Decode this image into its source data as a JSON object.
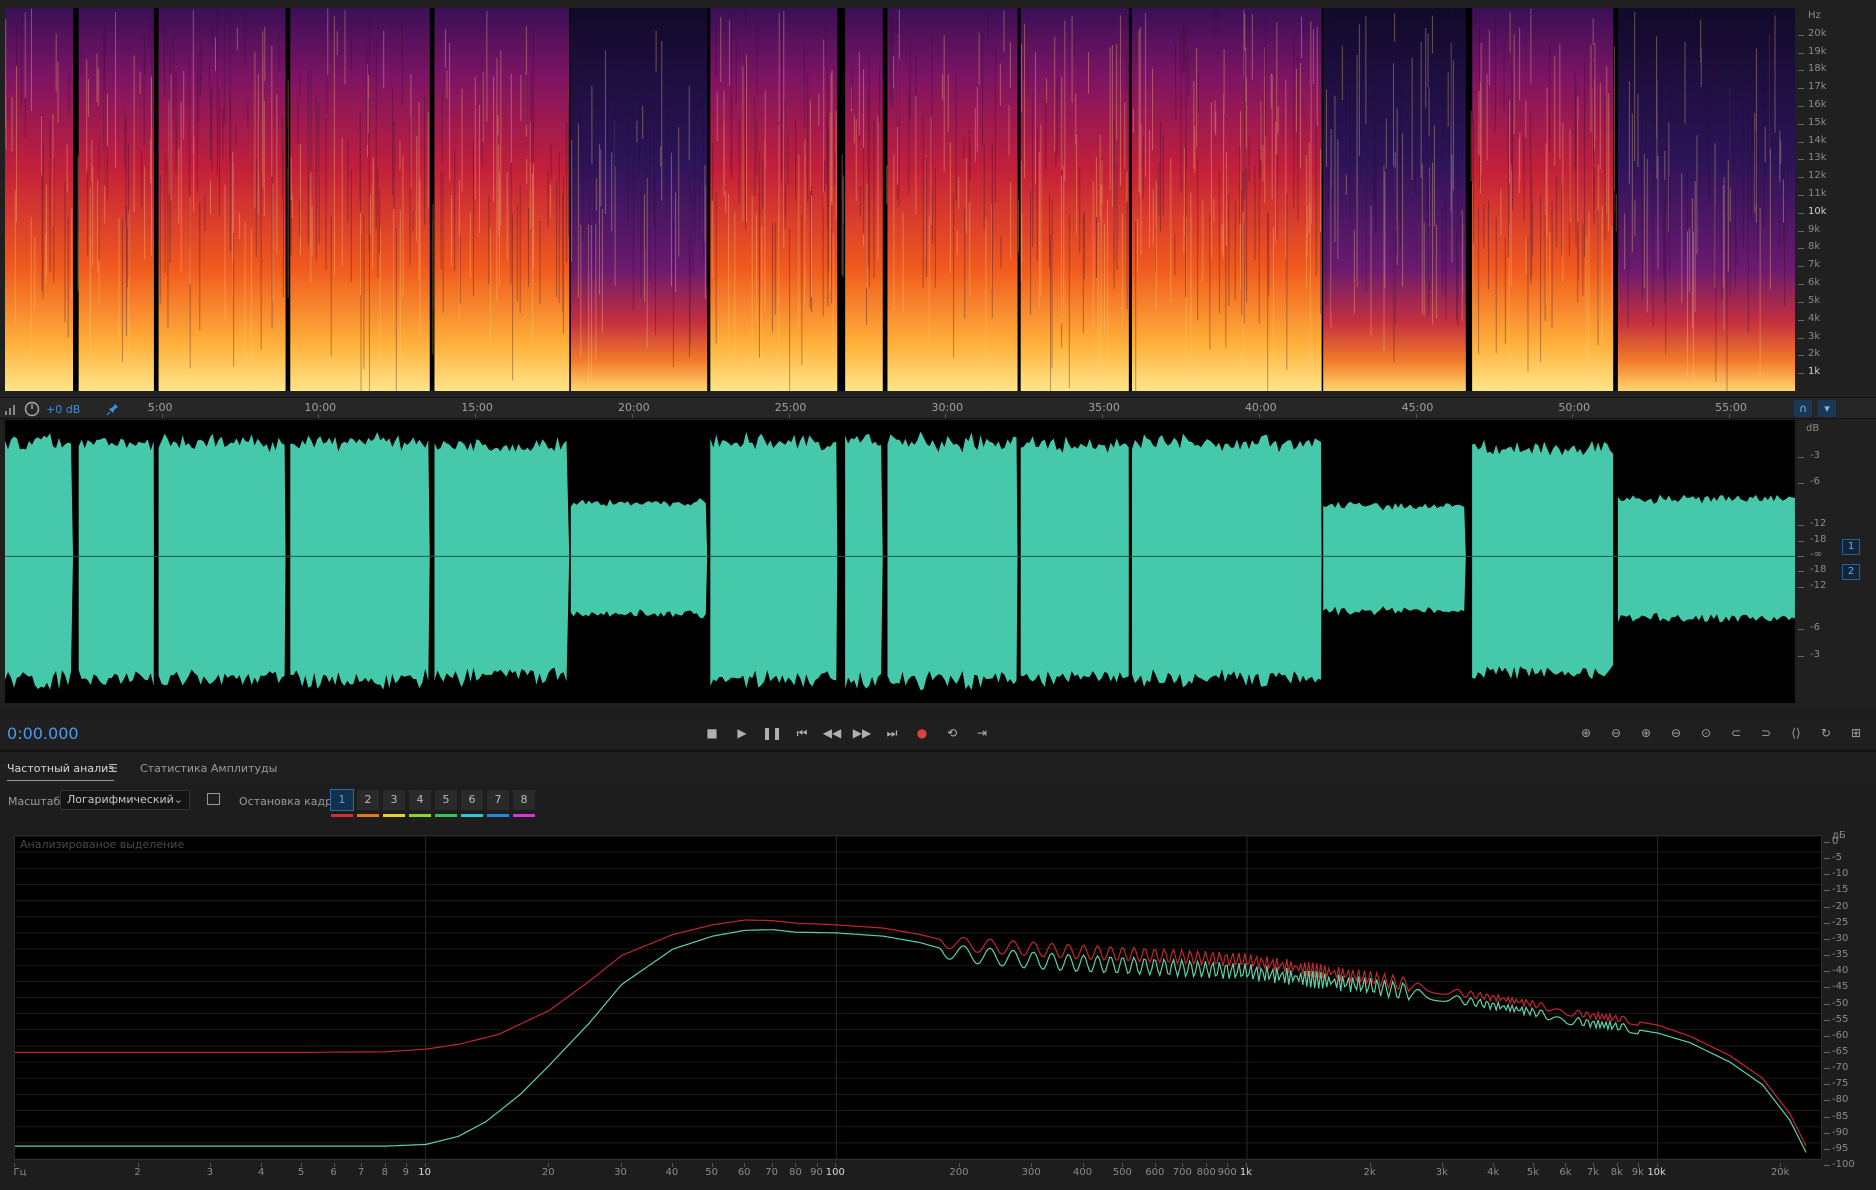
{
  "colors": {
    "wave": "#45c9aa",
    "accent": "#4a9cf0",
    "red_curve": "#c0282a",
    "green_curve": "#5bd2a6"
  },
  "spectrogram": {
    "unit": "Hz",
    "ticks": [
      {
        "label": "20k",
        "hz": 20000,
        "strong": false
      },
      {
        "label": "19k",
        "hz": 19000,
        "strong": false
      },
      {
        "label": "18k",
        "hz": 18000,
        "strong": false
      },
      {
        "label": "17k",
        "hz": 17000,
        "strong": false
      },
      {
        "label": "16k",
        "hz": 16000,
        "strong": false
      },
      {
        "label": "15k",
        "hz": 15000,
        "strong": false
      },
      {
        "label": "14k",
        "hz": 14000,
        "strong": false
      },
      {
        "label": "13k",
        "hz": 13000,
        "strong": false
      },
      {
        "label": "12k",
        "hz": 12000,
        "strong": false
      },
      {
        "label": "11k",
        "hz": 11000,
        "strong": false
      },
      {
        "label": "10k",
        "hz": 10000,
        "strong": true
      },
      {
        "label": "9k",
        "hz": 9000,
        "strong": false
      },
      {
        "label": "8k",
        "hz": 8000,
        "strong": false
      },
      {
        "label": "7k",
        "hz": 7000,
        "strong": false
      },
      {
        "label": "6k",
        "hz": 6000,
        "strong": false
      },
      {
        "label": "5k",
        "hz": 5000,
        "strong": false
      },
      {
        "label": "4k",
        "hz": 4000,
        "strong": false
      },
      {
        "label": "3k",
        "hz": 3000,
        "strong": false
      },
      {
        "label": "2k",
        "hz": 2000,
        "strong": false
      },
      {
        "label": "1k",
        "hz": 1000,
        "strong": true
      }
    ]
  },
  "timeline": {
    "gain_label": "+0 dB",
    "duration_min": 57.1,
    "labels": [
      {
        "text": "5:00",
        "min": 5
      },
      {
        "text": "10:00",
        "min": 10
      },
      {
        "text": "15:00",
        "min": 15
      },
      {
        "text": "20:00",
        "min": 20
      },
      {
        "text": "25:00",
        "min": 25
      },
      {
        "text": "30:00",
        "min": 30
      },
      {
        "text": "35:00",
        "min": 35
      },
      {
        "text": "40:00",
        "min": 40
      },
      {
        "text": "45:00",
        "min": 45
      },
      {
        "text": "50:00",
        "min": 50
      },
      {
        "text": "55:00",
        "min": 55
      }
    ]
  },
  "waveform": {
    "unit": "dB",
    "ticks": [
      {
        "label": "-3",
        "pos": 0.129
      },
      {
        "label": "-6",
        "pos": 0.224
      },
      {
        "label": "-12",
        "pos": 0.37
      },
      {
        "label": "-18",
        "pos": 0.426
      },
      {
        "label": "-∞",
        "pos": 0.482
      },
      {
        "label": "-18",
        "pos": 0.535
      },
      {
        "label": "-12",
        "pos": 0.59
      },
      {
        "label": "-6",
        "pos": 0.74
      },
      {
        "label": "-3",
        "pos": 0.835
      }
    ],
    "channels": [
      "1",
      "2"
    ],
    "segments": [
      {
        "start": 0.0,
        "end": 2.17,
        "level": 0.9
      },
      {
        "start": 2.35,
        "end": 4.75,
        "level": 0.9
      },
      {
        "start": 4.9,
        "end": 8.95,
        "level": 0.9
      },
      {
        "start": 9.1,
        "end": 13.55,
        "level": 0.9
      },
      {
        "start": 13.7,
        "end": 18.0,
        "level": 0.88
      },
      {
        "start": 18.05,
        "end": 22.4,
        "level": 0.42
      },
      {
        "start": 22.5,
        "end": 26.55,
        "level": 0.9
      },
      {
        "start": 26.8,
        "end": 28.0,
        "level": 0.9
      },
      {
        "start": 28.15,
        "end": 32.3,
        "level": 0.9
      },
      {
        "start": 32.4,
        "end": 35.85,
        "level": 0.88
      },
      {
        "start": 35.95,
        "end": 42.0,
        "level": 0.9
      },
      {
        "start": 42.05,
        "end": 46.6,
        "level": 0.4
      },
      {
        "start": 46.8,
        "end": 51.3,
        "level": 0.85
      },
      {
        "start": 51.45,
        "end": 57.1,
        "level": 0.45
      }
    ]
  },
  "transport": {
    "time": "0:00.000",
    "buttons": [
      "stop",
      "play",
      "pause",
      "to-start",
      "rewind",
      "fast-forward",
      "to-end",
      "record",
      "loop",
      "skip"
    ]
  },
  "tabs": {
    "frequency": "Частотный анализ",
    "menu_icon": "☰",
    "amplitude": "Статистика Амплитуды"
  },
  "controls": {
    "scale_label": "Масштаб:",
    "scale_value": "Логарифмический",
    "freeze_label": "Остановка кадра:",
    "freeze_buttons": [
      {
        "label": "1",
        "color": "#d62d2d",
        "active": true
      },
      {
        "label": "2",
        "color": "#e07a22",
        "active": false
      },
      {
        "label": "3",
        "color": "#e6d52a",
        "active": false
      },
      {
        "label": "4",
        "color": "#8ad62e",
        "active": false
      },
      {
        "label": "5",
        "color": "#35c05a",
        "active": false
      },
      {
        "label": "6",
        "color": "#2dc7d8",
        "active": false
      },
      {
        "label": "7",
        "color": "#2d85e0",
        "active": false
      },
      {
        "label": "8",
        "color": "#d33ad6",
        "active": false
      }
    ]
  },
  "chart_data": {
    "type": "line",
    "title": "Анализированое выделение",
    "xlabel": "Гц",
    "ylabel": "дБ",
    "x_scale": "log",
    "xlim": [
      1,
      25000
    ],
    "ylim": [
      -100,
      0
    ],
    "x_ticks": [
      {
        "label": "Гц",
        "hz": 1,
        "strong": false
      },
      {
        "label": "2",
        "hz": 2,
        "strong": false
      },
      {
        "label": "3",
        "hz": 3,
        "strong": false
      },
      {
        "label": "4",
        "hz": 4,
        "strong": false
      },
      {
        "label": "5",
        "hz": 5,
        "strong": false
      },
      {
        "label": "6",
        "hz": 6,
        "strong": false
      },
      {
        "label": "7",
        "hz": 7,
        "strong": false
      },
      {
        "label": "8",
        "hz": 8,
        "strong": false
      },
      {
        "label": "9",
        "hz": 9,
        "strong": false
      },
      {
        "label": "10",
        "hz": 10,
        "strong": true
      },
      {
        "label": "20",
        "hz": 20,
        "strong": false
      },
      {
        "label": "30",
        "hz": 30,
        "strong": false
      },
      {
        "label": "40",
        "hz": 40,
        "strong": false
      },
      {
        "label": "50",
        "hz": 50,
        "strong": false
      },
      {
        "label": "60",
        "hz": 60,
        "strong": false
      },
      {
        "label": "70",
        "hz": 70,
        "strong": false
      },
      {
        "label": "80",
        "hz": 80,
        "strong": false
      },
      {
        "label": "90",
        "hz": 90,
        "strong": false
      },
      {
        "label": "100",
        "hz": 100,
        "strong": true
      },
      {
        "label": "200",
        "hz": 200,
        "strong": false
      },
      {
        "label": "300",
        "hz": 300,
        "strong": false
      },
      {
        "label": "400",
        "hz": 400,
        "strong": false
      },
      {
        "label": "500",
        "hz": 500,
        "strong": false
      },
      {
        "label": "600",
        "hz": 600,
        "strong": false
      },
      {
        "label": "700",
        "hz": 700,
        "strong": false
      },
      {
        "label": "800",
        "hz": 800,
        "strong": false
      },
      {
        "label": "900",
        "hz": 900,
        "strong": false
      },
      {
        "label": "1k",
        "hz": 1000,
        "strong": true
      },
      {
        "label": "2k",
        "hz": 2000,
        "strong": false
      },
      {
        "label": "3k",
        "hz": 3000,
        "strong": false
      },
      {
        "label": "4k",
        "hz": 4000,
        "strong": false
      },
      {
        "label": "5k",
        "hz": 5000,
        "strong": false
      },
      {
        "label": "6k",
        "hz": 6000,
        "strong": false
      },
      {
        "label": "7k",
        "hz": 7000,
        "strong": false
      },
      {
        "label": "8k",
        "hz": 8000,
        "strong": false
      },
      {
        "label": "9k",
        "hz": 9000,
        "strong": false
      },
      {
        "label": "10k",
        "hz": 10000,
        "strong": true
      },
      {
        "label": "20k",
        "hz": 20000,
        "strong": false
      }
    ],
    "y_ticks": [
      {
        "label": "дБ",
        "db": null
      },
      {
        "label": "0",
        "db": 0
      },
      {
        "label": "-5",
        "db": -5
      },
      {
        "label": "-10",
        "db": -10
      },
      {
        "label": "-15",
        "db": -15
      },
      {
        "label": "-20",
        "db": -20
      },
      {
        "label": "-25",
        "db": -25
      },
      {
        "label": "-30",
        "db": -30
      },
      {
        "label": "-35",
        "db": -35
      },
      {
        "label": "-40",
        "db": -40
      },
      {
        "label": "-45",
        "db": -45
      },
      {
        "label": "-50",
        "db": -50
      },
      {
        "label": "-55",
        "db": -55
      },
      {
        "label": "-60",
        "db": -60
      },
      {
        "label": "-65",
        "db": -65
      },
      {
        "label": "-70",
        "db": -70
      },
      {
        "label": "-75",
        "db": -75
      },
      {
        "label": "-80",
        "db": -80
      },
      {
        "label": "-85",
        "db": -85
      },
      {
        "label": "-90",
        "db": -90
      },
      {
        "label": "-95",
        "db": -95
      },
      {
        "label": "-100",
        "db": -100
      }
    ],
    "series": [
      {
        "color": "#c0282a",
        "points": [
          [
            1,
            -67
          ],
          [
            5,
            -67
          ],
          [
            8,
            -66.8
          ],
          [
            10,
            -66
          ],
          [
            12,
            -64.5
          ],
          [
            15,
            -61.5
          ],
          [
            20,
            -54
          ],
          [
            25,
            -45
          ],
          [
            30,
            -37
          ],
          [
            40,
            -30.5
          ],
          [
            50,
            -27.5
          ],
          [
            60,
            -26
          ],
          [
            70,
            -26.2
          ],
          [
            80,
            -27
          ],
          [
            100,
            -27.5
          ],
          [
            130,
            -28.5
          ],
          [
            160,
            -30.5
          ],
          [
            200,
            -33.5
          ],
          [
            300,
            -35
          ],
          [
            400,
            -36
          ],
          [
            600,
            -37
          ],
          [
            1000,
            -38.5
          ],
          [
            2000,
            -44
          ],
          [
            3000,
            -48
          ],
          [
            4000,
            -50
          ],
          [
            5000,
            -52
          ],
          [
            6000,
            -54.5
          ],
          [
            8000,
            -56.5
          ],
          [
            10000,
            -58.5
          ],
          [
            12000,
            -62
          ],
          [
            15000,
            -68
          ],
          [
            18000,
            -75
          ],
          [
            21000,
            -86
          ],
          [
            23000,
            -96
          ]
        ]
      },
      {
        "color": "#5bd2a6",
        "points": [
          [
            1,
            -96
          ],
          [
            8,
            -96
          ],
          [
            10,
            -95.5
          ],
          [
            12,
            -93
          ],
          [
            14,
            -88.5
          ],
          [
            17,
            -80
          ],
          [
            20,
            -71
          ],
          [
            25,
            -58
          ],
          [
            30,
            -46
          ],
          [
            40,
            -35
          ],
          [
            50,
            -31
          ],
          [
            60,
            -29.2
          ],
          [
            70,
            -29
          ],
          [
            80,
            -29.8
          ],
          [
            100,
            -30
          ],
          [
            130,
            -31
          ],
          [
            160,
            -33
          ],
          [
            200,
            -36.5
          ],
          [
            300,
            -38.5
          ],
          [
            400,
            -39.5
          ],
          [
            600,
            -40.5
          ],
          [
            1000,
            -42
          ],
          [
            2000,
            -46.5
          ],
          [
            3000,
            -50
          ],
          [
            4000,
            -52.5
          ],
          [
            5000,
            -54.5
          ],
          [
            6000,
            -57
          ],
          [
            8000,
            -59
          ],
          [
            10000,
            -61
          ],
          [
            12000,
            -64
          ],
          [
            15000,
            -70
          ],
          [
            18000,
            -77
          ],
          [
            21000,
            -88
          ],
          [
            23000,
            -98
          ]
        ]
      }
    ]
  }
}
